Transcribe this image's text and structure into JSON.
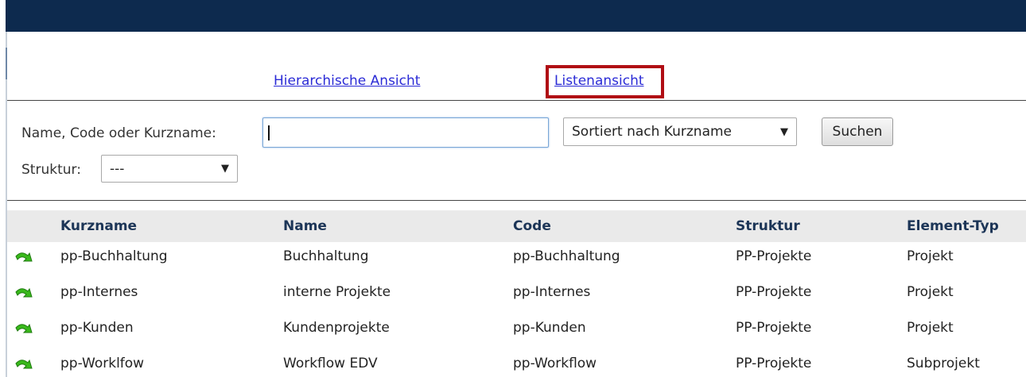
{
  "views": {
    "hierarchical_label": "Hierarchische Ansicht",
    "list_label": "Listenansicht"
  },
  "search": {
    "label": "Name, Code oder Kurzname:",
    "value": "",
    "sort_selected": "Sortiert nach Kurzname",
    "button_label": "Suchen",
    "structure_label": "Struktur:",
    "structure_selected": "---"
  },
  "table": {
    "headers": [
      "Kurzname",
      "Name",
      "Code",
      "Struktur",
      "Element-Typ"
    ],
    "rows": [
      [
        "pp-Buchhaltung",
        "Buchhaltung",
        "pp-Buchhaltung",
        "PP-Projekte",
        "Projekt"
      ],
      [
        "pp-Internes",
        "interne Projekte",
        "pp-Internes",
        "PP-Projekte",
        "Projekt"
      ],
      [
        "pp-Kunden",
        "Kundenprojekte",
        "pp-Kunden",
        "PP-Projekte",
        "Projekt"
      ],
      [
        "pp-Worklfow",
        "Workflow EDV",
        "pp-Workflow",
        "PP-Projekte",
        "Subprojekt"
      ]
    ]
  },
  "icons": {
    "row_action": "green-arrow-icon",
    "dropdown": "triangle-down-icon"
  },
  "colors": {
    "top_bar": "#0d2a4e",
    "link": "#2b2bd6",
    "highlight_box": "#b00d14",
    "header_text": "#1c3557",
    "arrow_green": "#39b91b"
  }
}
